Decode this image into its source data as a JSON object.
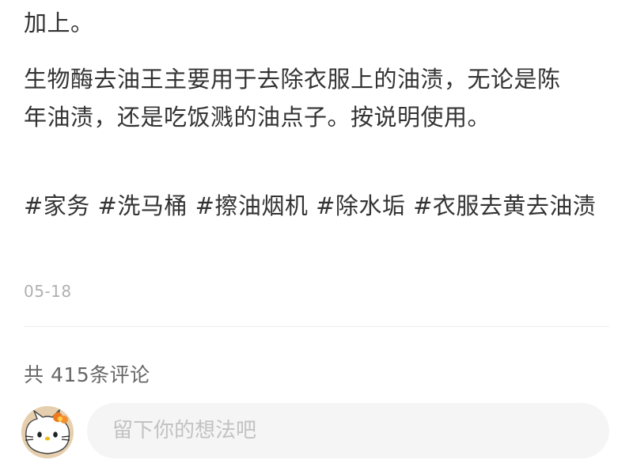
{
  "post": {
    "text_tail": "加上。",
    "body": "生物酶去油王主要用于去除衣服上的油渍，无论是陈年油渍，还是吃饭溅的油点子。按说明使用。",
    "tags": [
      "#家务",
      "#洗马桶",
      "#擦油烟机",
      "#除水垢",
      "#衣服去黄去油渍"
    ],
    "date": "05-18"
  },
  "comments": {
    "count_text": "共 415条评论",
    "input_placeholder": "留下你的想法吧",
    "avatar_icon": "hello-kitty-avatar-icon"
  }
}
